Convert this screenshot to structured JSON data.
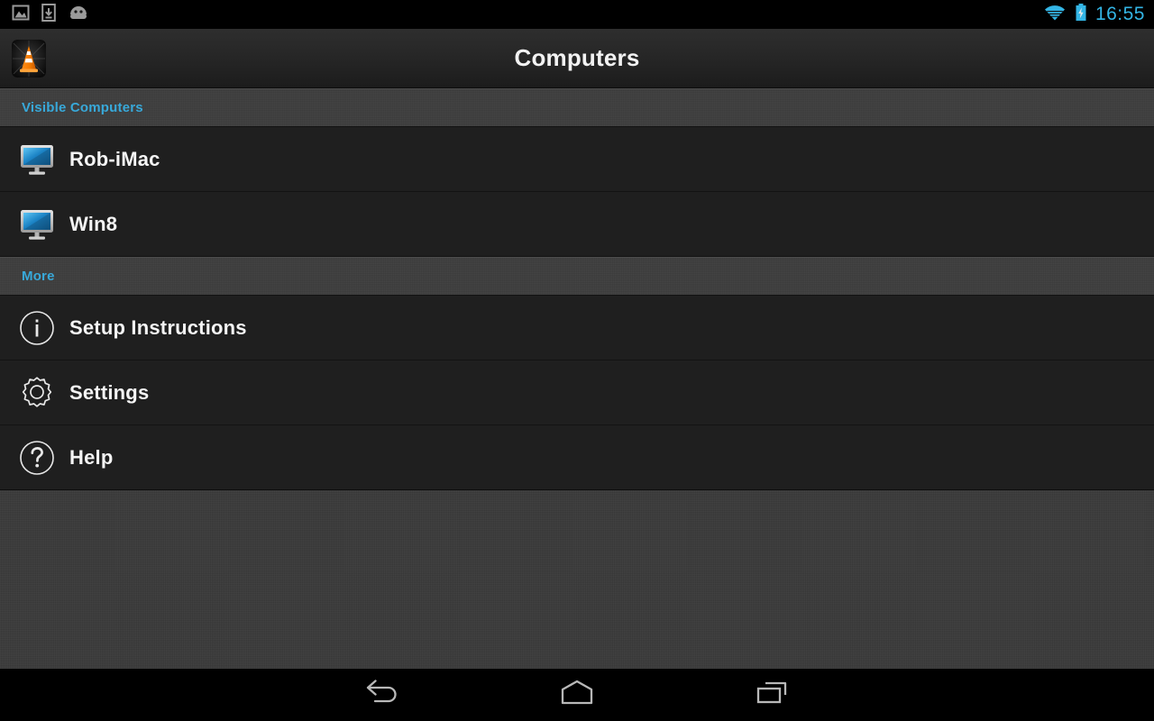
{
  "status_bar": {
    "notification_icons": [
      {
        "name": "screenshot-image-icon",
        "label": "Screenshot"
      },
      {
        "name": "download-complete-icon",
        "label": "Download complete"
      },
      {
        "name": "android-head-icon",
        "label": "Android system"
      }
    ],
    "wifi_icon": "wifi-icon",
    "battery_icon": "battery-charging-icon",
    "clock": "16:55",
    "clock_color": "#33b5e5"
  },
  "action_bar": {
    "app_icon": "vlc-cone-icon",
    "title": "Computers"
  },
  "sections": [
    {
      "header": "Visible Computers",
      "header_color": "#38a9da",
      "items": [
        {
          "icon": "computer-monitor-icon",
          "label": "Rob-iMac"
        },
        {
          "icon": "computer-monitor-icon",
          "label": "Win8"
        }
      ]
    },
    {
      "header": "More",
      "header_color": "#38a9da",
      "items": [
        {
          "icon": "info-circle-icon",
          "label": "Setup Instructions"
        },
        {
          "icon": "gear-icon",
          "label": "Settings"
        },
        {
          "icon": "question-circle-icon",
          "label": "Help"
        }
      ]
    }
  ],
  "nav_bar": {
    "back": "back-icon",
    "home": "home-icon",
    "recents": "recent-apps-icon"
  }
}
